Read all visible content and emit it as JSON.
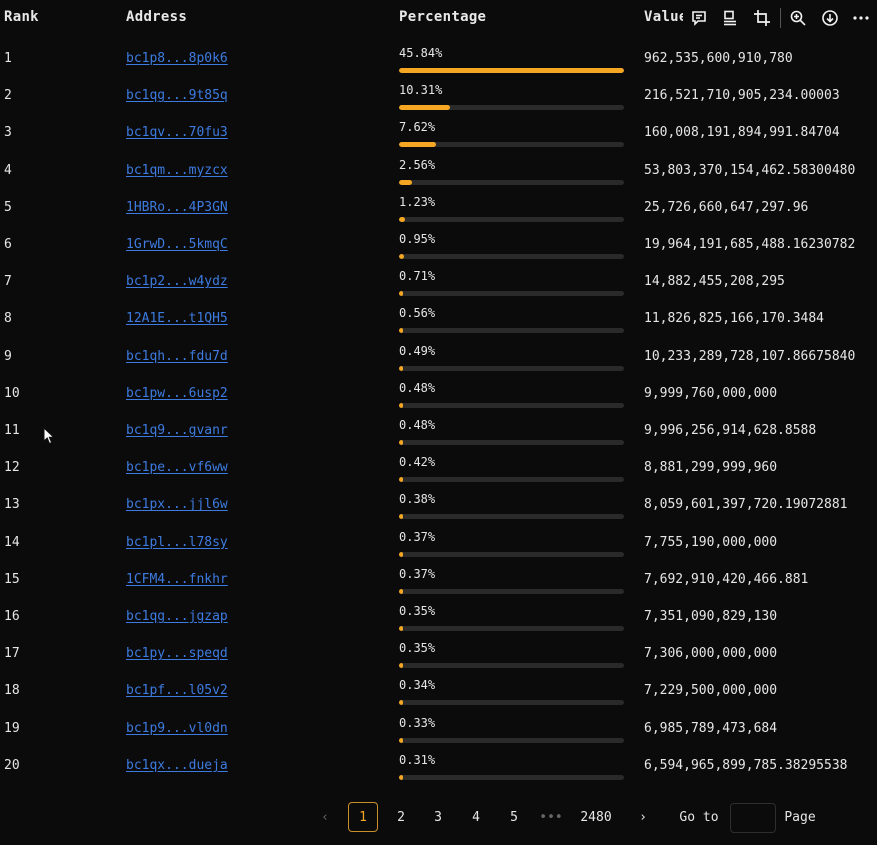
{
  "header": {
    "rank": "Rank",
    "address": "Address",
    "percentage": "Percentage",
    "value": "Value"
  },
  "toolbar": [
    "comment-icon",
    "layout-icon",
    "crop-icon",
    "zoom-in-icon",
    "download-icon",
    "more-icon"
  ],
  "rows": [
    {
      "rank": "1",
      "address": "bc1p8...8p0k6",
      "pct": "45.84%",
      "frac": 0.4584,
      "value": "962,535,600,910,780"
    },
    {
      "rank": "2",
      "address": "bc1qg...9t85q",
      "pct": "10.31%",
      "frac": 0.1031,
      "value": "216,521,710,905,234.00003"
    },
    {
      "rank": "3",
      "address": "bc1qv...70fu3",
      "pct": "7.62%",
      "frac": 0.0762,
      "value": "160,008,191,894,991.84704"
    },
    {
      "rank": "4",
      "address": "bc1qm...myzcx",
      "pct": "2.56%",
      "frac": 0.0256,
      "value": "53,803,370,154,462.58300480"
    },
    {
      "rank": "5",
      "address": "1HBRo...4P3GN",
      "pct": "1.23%",
      "frac": 0.0123,
      "value": "25,726,660,647,297.96"
    },
    {
      "rank": "6",
      "address": "1GrwD...5kmqC",
      "pct": "0.95%",
      "frac": 0.0095,
      "value": "19,964,191,685,488.16230782"
    },
    {
      "rank": "7",
      "address": "bc1p2...w4ydz",
      "pct": "0.71%",
      "frac": 0.0071,
      "value": "14,882,455,208,295"
    },
    {
      "rank": "8",
      "address": "12A1E...t1QH5",
      "pct": "0.56%",
      "frac": 0.0056,
      "value": "11,826,825,166,170.3484"
    },
    {
      "rank": "9",
      "address": "bc1qh...fdu7d",
      "pct": "0.49%",
      "frac": 0.0049,
      "value": "10,233,289,728,107.86675840"
    },
    {
      "rank": "10",
      "address": "bc1pw...6usp2",
      "pct": "0.48%",
      "frac": 0.0048,
      "value": "9,999,760,000,000"
    },
    {
      "rank": "11",
      "address": "bc1q9...gvanr",
      "pct": "0.48%",
      "frac": 0.0048,
      "value": "9,996,256,914,628.8588"
    },
    {
      "rank": "12",
      "address": "bc1pe...vf6ww",
      "pct": "0.42%",
      "frac": 0.0042,
      "value": "8,881,299,999,960"
    },
    {
      "rank": "13",
      "address": "bc1px...jjl6w",
      "pct": "0.38%",
      "frac": 0.0038,
      "value": "8,059,601,397,720.19072881"
    },
    {
      "rank": "14",
      "address": "bc1pl...l78sy",
      "pct": "0.37%",
      "frac": 0.0037,
      "value": "7,755,190,000,000"
    },
    {
      "rank": "15",
      "address": "1CFM4...fnkhr",
      "pct": "0.37%",
      "frac": 0.0037,
      "value": "7,692,910,420,466.881"
    },
    {
      "rank": "16",
      "address": "bc1qg...jgzap",
      "pct": "0.35%",
      "frac": 0.0035,
      "value": "7,351,090,829,130"
    },
    {
      "rank": "17",
      "address": "bc1py...speqd",
      "pct": "0.35%",
      "frac": 0.0035,
      "value": "7,306,000,000,000"
    },
    {
      "rank": "18",
      "address": "bc1pf...l05v2",
      "pct": "0.34%",
      "frac": 0.0034,
      "value": "7,229,500,000,000"
    },
    {
      "rank": "19",
      "address": "bc1p9...vl0dn",
      "pct": "0.33%",
      "frac": 0.0033,
      "value": "6,985,789,473,684"
    },
    {
      "rank": "20",
      "address": "bc1qx...dueja",
      "pct": "0.31%",
      "frac": 0.0031,
      "value": "6,594,965,899,785.38295538"
    }
  ],
  "pagination": {
    "prev": "‹",
    "pages": [
      "1",
      "2",
      "3",
      "4",
      "5"
    ],
    "ellipsis": "•••",
    "last": "2480",
    "next": "›",
    "current": "1",
    "goto_label": "Go to",
    "page_label": "Page"
  },
  "colors": {
    "accent": "#f5a623",
    "link": "#3d7be0",
    "background": "#0b0b0b"
  }
}
